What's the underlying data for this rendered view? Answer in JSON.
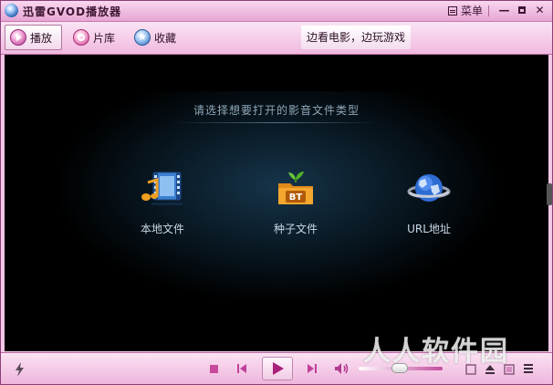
{
  "window": {
    "title": "迅雷GVOD播放器",
    "menu_label": "菜单",
    "minimize_glyph": "—",
    "close_glyph": "✕"
  },
  "toolbar": {
    "play_label": "播放",
    "library_label": "片库",
    "favorites_label": "收藏",
    "active_tab": "播放",
    "promo_label": "边看电影，边玩游戏"
  },
  "main": {
    "prompt": "请选择想要打开的影音文件类型",
    "options": [
      {
        "label": "本地文件",
        "icon": "film-music-icon"
      },
      {
        "label": "种子文件",
        "icon": "bt-folder-icon"
      },
      {
        "label": "URL地址",
        "icon": "globe-icon"
      }
    ],
    "bt_badge": "BT"
  },
  "controls": {
    "icons": [
      "bolt-icon",
      "stop-icon",
      "previous-icon",
      "play-icon",
      "next-icon",
      "volume-icon",
      "playlist-icon",
      "eject-icon",
      "fullscreen-icon",
      "list-icon"
    ],
    "volume_level": 0.5
  },
  "watermark": "人人软件园",
  "colors": {
    "accent_pink": "#c94a9c",
    "chrome_pink": "#f2c8e6",
    "content_bg": "#000000"
  }
}
